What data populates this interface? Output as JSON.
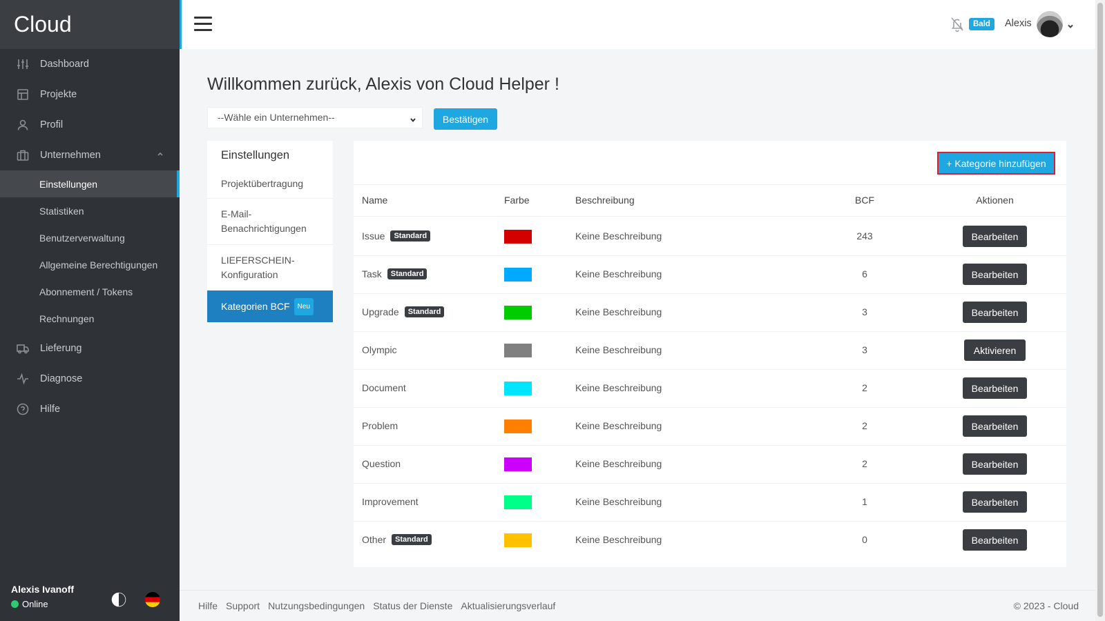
{
  "brand": "Cloud",
  "sidebar": {
    "items": [
      {
        "label": "Dashboard",
        "icon": "sliders-icon"
      },
      {
        "label": "Projekte",
        "icon": "layout-icon"
      },
      {
        "label": "Profil",
        "icon": "user-icon"
      },
      {
        "label": "Unternehmen",
        "icon": "briefcase-icon"
      }
    ],
    "subitems": [
      "Einstellungen",
      "Statistiken",
      "Benutzerverwaltung",
      "Allgemeine Berechtigungen",
      "Abonnement / Tokens",
      "Rechnungen"
    ],
    "items_after": [
      {
        "label": "Lieferung",
        "icon": "truck-icon"
      },
      {
        "label": "Diagnose",
        "icon": "activity-icon"
      },
      {
        "label": "Hilfe",
        "icon": "help-circle-icon"
      }
    ],
    "footer": {
      "user": "Alexis Ivanoff",
      "status": "Online"
    }
  },
  "topbar": {
    "badge": "Bald",
    "username": "Alexis"
  },
  "main": {
    "welcome": "Willkommen zurück, Alexis von Cloud Helper !",
    "company_select": "--Wähle ein Unternehmen--",
    "confirm_label": "Bestätigen"
  },
  "settings_menu": {
    "title": "Einstellungen",
    "items": [
      "Projektübertragung",
      "E-Mail-Benachrichtigungen",
      "LIEFERSCHEIN-Konfiguration"
    ],
    "active": "Kategorien BCF",
    "active_badge": "Neu"
  },
  "categories": {
    "add_label": "+ Kategorie hinzufügen",
    "headers": {
      "name": "Name",
      "color": "Farbe",
      "description": "Beschreibung",
      "bcf": "BCF",
      "actions": "Aktionen"
    },
    "standard_label": "Standard",
    "rows": [
      {
        "name": "Issue",
        "standard": true,
        "color": "#d40000",
        "description": "Keine Beschreibung",
        "bcf": "243",
        "action": "Bearbeiten"
      },
      {
        "name": "Task",
        "standard": true,
        "color": "#00aaff",
        "description": "Keine Beschreibung",
        "bcf": "6",
        "action": "Bearbeiten"
      },
      {
        "name": "Upgrade",
        "standard": true,
        "color": "#00cc00",
        "description": "Keine Beschreibung",
        "bcf": "3",
        "action": "Bearbeiten"
      },
      {
        "name": "Olympic",
        "standard": false,
        "color": "#808080",
        "description": "Keine Beschreibung",
        "bcf": "3",
        "action": "Aktivieren"
      },
      {
        "name": "Document",
        "standard": false,
        "color": "#00e5ff",
        "description": "Keine Beschreibung",
        "bcf": "2",
        "action": "Bearbeiten"
      },
      {
        "name": "Problem",
        "standard": false,
        "color": "#ff7f00",
        "description": "Keine Beschreibung",
        "bcf": "2",
        "action": "Bearbeiten"
      },
      {
        "name": "Question",
        "standard": false,
        "color": "#cc00ff",
        "description": "Keine Beschreibung",
        "bcf": "2",
        "action": "Bearbeiten"
      },
      {
        "name": "Improvement",
        "standard": false,
        "color": "#00ff88",
        "description": "Keine Beschreibung",
        "bcf": "1",
        "action": "Bearbeiten"
      },
      {
        "name": "Other",
        "standard": true,
        "color": "#ffc000",
        "description": "Keine Beschreibung",
        "bcf": "0",
        "action": "Bearbeiten"
      }
    ]
  },
  "footer": {
    "links": [
      "Hilfe",
      "Support",
      "Nutzungsbedingungen",
      "Status der Dienste",
      "Aktualisierungsverlauf"
    ],
    "copyright": "© 2023 - Cloud"
  },
  "colors": {
    "accent": "#1ea7e0",
    "sidebar_bg": "#2f3237",
    "active_menu": "#1e80c1",
    "dark_button": "#3a3d42"
  }
}
